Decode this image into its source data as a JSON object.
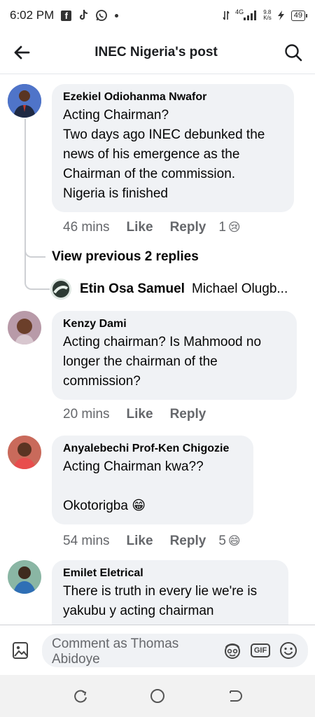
{
  "status_bar": {
    "time": "6:02 PM",
    "network": "4G",
    "speed_value": "9.8",
    "speed_unit": "K/s",
    "battery": "49"
  },
  "header": {
    "title": "INEC Nigeria's post",
    "back_icon": "arrow-left-icon",
    "search_icon": "search-icon"
  },
  "comments": [
    {
      "name": "Ezekiel Odiohanma Nwafor",
      "text": "Acting Chairman?\nTwo days ago INEC debunked the news of his emergence as the Chairman of the commission.\nNigeria is finished",
      "time": "46 mins",
      "like": "Like",
      "reply": "Reply",
      "reaction_count": "1",
      "reaction": "😢"
    },
    {
      "name": "Kenzy Dami",
      "text": "Acting chairman? Is Mahmood no longer the chairman of the commission?",
      "time": "20 mins",
      "like": "Like",
      "reply": "Reply"
    },
    {
      "name": "Anyalebechi Prof-Ken Chigozie",
      "text": "Acting Chairman kwa??\n\nOkotorigba 😁",
      "time": "54 mins",
      "like": "Like",
      "reply": "Reply",
      "reaction_count": "5",
      "reaction": "😄"
    },
    {
      "name": "Emilet Eletrical",
      "text": "There is truth in every lie we're is yakubu y acting chairman"
    }
  ],
  "thread": {
    "view_previous": "View previous 2 replies",
    "reply_name": "Etin Osa Samuel",
    "reply_text": "Michael Olugb..."
  },
  "composer": {
    "placeholder": "Comment as Thomas Abidoye",
    "gif_label": "GIF"
  },
  "colors": {
    "bubble": "#f0f2f5",
    "muted": "#65676b",
    "thread_line": "#ced0d4"
  }
}
